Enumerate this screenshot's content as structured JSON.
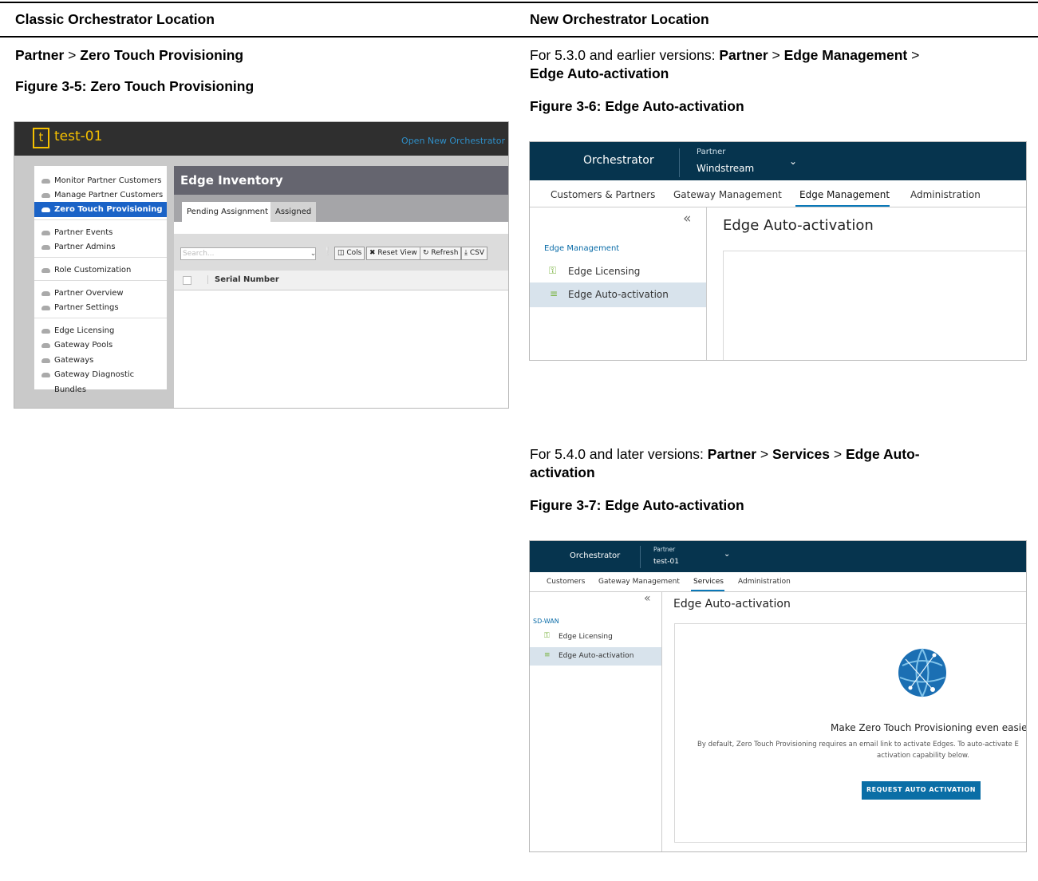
{
  "table_header": {
    "classic": "Classic Orchestrator Location",
    "new": "New Orchestrator Location"
  },
  "classic": {
    "path_a": "Partner",
    "path_sep": ">",
    "path_b": "Zero Touch Provisioning",
    "figure_caption": "Figure 3-5: Zero Touch Provisioning",
    "screenshot": {
      "logo_letter": "t",
      "instance_name": "test-01",
      "open_link": "Open New Orchestrator",
      "menu": [
        "Monitor Partner Customers",
        "Manage Partner Customers",
        "Zero Touch Provisioning",
        "Partner Events",
        "Partner Admins",
        "Role Customization",
        "Partner Overview",
        "Partner Settings",
        "Edge Licensing",
        "Gateway Pools",
        "Gateways",
        "Gateway Diagnostic Bundles"
      ],
      "panel_title": "Edge Inventory",
      "tabs": [
        "Pending Assignment",
        "Assigned"
      ],
      "search_placeholder": "Search...",
      "buttons": [
        "Cols",
        "Reset View",
        "Refresh",
        "CSV"
      ],
      "column_header": "Serial Number"
    }
  },
  "new_a": {
    "intro": "For 5.3.0 and earlier versions:",
    "path_a": "Partner",
    "path_b": "Edge Management",
    "path_c": "Edge Auto-activation",
    "figure_caption": "Figure 3-6: Edge Auto-activation",
    "screenshot": {
      "brand": "Orchestrator",
      "partner_label": "Partner",
      "partner_value": "Windstream",
      "tabs": [
        "Customers & Partners",
        "Gateway Management",
        "Edge Management",
        "Administration"
      ],
      "section": "Edge Management",
      "items": [
        "Edge Licensing",
        "Edge Auto-activation"
      ],
      "page_title": "Edge Auto-activation"
    }
  },
  "new_b": {
    "intro": "For 5.4.0 and later versions:",
    "path_a": "Partner",
    "path_b": "Services",
    "path_c_1": "Edge Auto-",
    "path_c_2": "activation",
    "figure_caption": "Figure 3-7: Edge Auto-activation",
    "screenshot": {
      "brand": "Orchestrator",
      "partner_label": "Partner",
      "partner_value": "test-01",
      "tabs": [
        "Customers",
        "Gateway Management",
        "Services",
        "Administration"
      ],
      "section": "SD-WAN",
      "items": [
        "Edge Licensing",
        "Edge Auto-activation"
      ],
      "page_title": "Edge Auto-activation",
      "promo_title": "Make Zero Touch Provisioning even easier!",
      "promo_line1": "By default, Zero Touch Provisioning requires an email link to activate Edges. To auto-activate E",
      "promo_line2": "activation capability below.",
      "button": "REQUEST AUTO ACTIVATION"
    }
  },
  "icons": {
    "collapse": "double-chevron-left-icon",
    "caret": "chevron-down-icon",
    "key": "key-icon",
    "auto_activation": "lines-icon",
    "globe": "globe-icon",
    "cloud": "cloud-icon"
  },
  "colors": {
    "nav_bg": "#06344e",
    "accent": "#0a78b8",
    "classic_active": "#1b63c7",
    "classic_logo": "#f5c000"
  }
}
